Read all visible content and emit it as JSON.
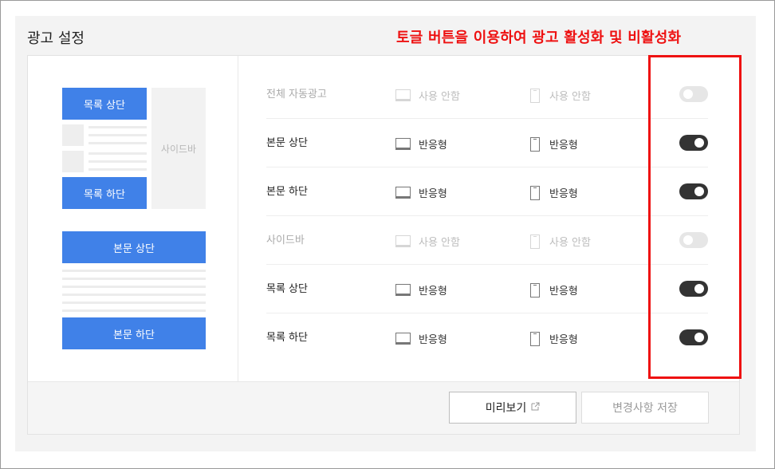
{
  "panel": {
    "title": "광고 설정"
  },
  "annotation": {
    "text": "토글 버튼을 이용하여 광고 활성화 및 비활성화"
  },
  "preview": {
    "list_top": "목록 상단",
    "list_bottom": "목록 하단",
    "sidebar": "사이드바",
    "body_top": "본문 상단",
    "body_bottom": "본문 하단"
  },
  "settings": {
    "rows": [
      {
        "label": "전체 자동광고",
        "pc": "사용 안함",
        "mobile": "사용 안함",
        "enabled": false
      },
      {
        "label": "본문 상단",
        "pc": "반응형",
        "mobile": "반응형",
        "enabled": true
      },
      {
        "label": "본문 하단",
        "pc": "반응형",
        "mobile": "반응형",
        "enabled": true
      },
      {
        "label": "사이드바",
        "pc": "사용 안함",
        "mobile": "사용 안함",
        "enabled": false
      },
      {
        "label": "목록 상단",
        "pc": "반응형",
        "mobile": "반응형",
        "enabled": true
      },
      {
        "label": "목록 하단",
        "pc": "반응형",
        "mobile": "반응형",
        "enabled": true
      }
    ]
  },
  "footer": {
    "preview_button": "미리보기",
    "save_button": "변경사항 저장"
  },
  "colors": {
    "accent": "#4081e8",
    "toggle_on": "#333333",
    "toggle_off": "#e6e6e6",
    "annotation": "#ee1111"
  }
}
